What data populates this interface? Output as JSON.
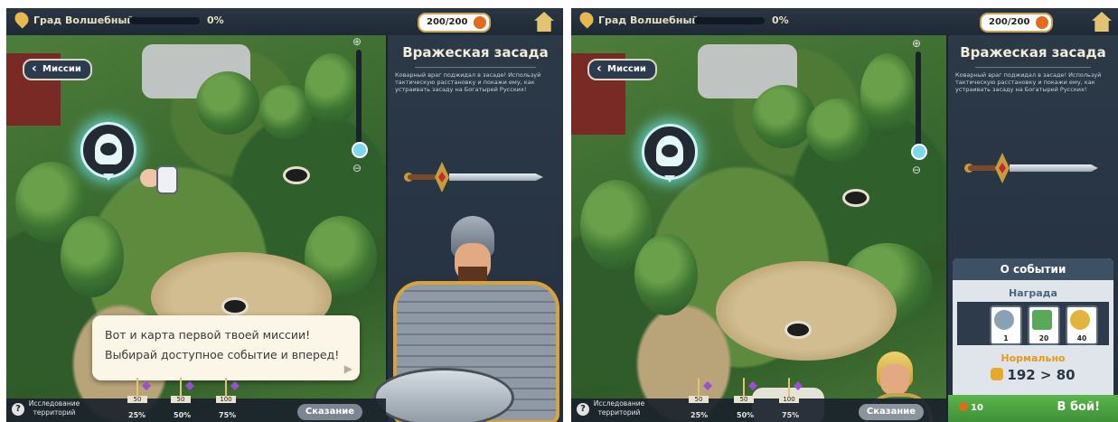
{
  "screens": [
    {
      "topbar": {
        "city": "Град Волшебный",
        "progress_text": "0%",
        "energy": "200/200"
      },
      "missions_label": "Миссии",
      "panel": {
        "title": "Вражеская засада",
        "description": "Коварный враг поджидал в засаде! Используй тактическую расстановку и покажи ему, как устраивать засаду на Богатырей Русских!"
      },
      "bubble": {
        "line1": "Вот и карта первой твоей миссии!",
        "line2": "Выбирай доступное событие и вперед!"
      },
      "bottom": {
        "explore_label": "Исследование территорий",
        "milestones": [
          {
            "count": "50",
            "pct": "25%"
          },
          {
            "count": "50",
            "pct": "50%"
          },
          {
            "count": "100",
            "pct": "75%"
          }
        ],
        "story_button": "Сказание"
      }
    },
    {
      "topbar": {
        "city": "Град Волшебный",
        "progress_text": "0%",
        "energy": "200/200"
      },
      "missions_label": "Миссии",
      "panel": {
        "title": "Вражеская засада",
        "description": "Коварный враг поджидал в засаде! Используй тактическую расстановку и покажи ему, как устраивать засаду на Богатырей Русских!"
      },
      "event": {
        "header": "О событии",
        "reward_label": "Награда",
        "rewards": [
          {
            "icon": "token-icon",
            "qty": "1",
            "color": "#8aa0b5"
          },
          {
            "icon": "scroll-icon",
            "qty": "20",
            "color": "#5aa85a"
          },
          {
            "icon": "gold-coin-icon",
            "qty": "40",
            "color": "#e2b43a"
          }
        ],
        "difficulty": "Нормально",
        "power": "192 > 80",
        "fight_cost": "10",
        "fight_button": "В бой!"
      },
      "bottom": {
        "explore_label": "Исследование территорий",
        "milestones": [
          {
            "count": "50",
            "pct": "25%"
          },
          {
            "count": "50",
            "pct": "50%"
          },
          {
            "count": "100",
            "pct": "75%"
          }
        ],
        "story_button": "Сказание"
      }
    }
  ]
}
